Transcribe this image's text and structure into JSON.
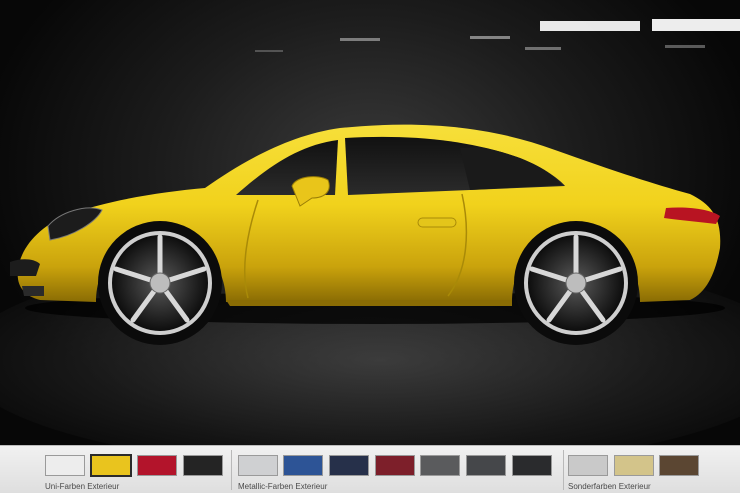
{
  "scene": {
    "subject": "car-side-view"
  },
  "palette": {
    "groups": [
      {
        "label": "Uni-Farben Exterieur",
        "swatches": [
          {
            "color": "#ededed",
            "name": "white"
          },
          {
            "color": "#e9c41e",
            "name": "yellow",
            "selected": true
          },
          {
            "color": "#b3142b",
            "name": "red"
          },
          {
            "color": "#242424",
            "name": "black"
          }
        ]
      },
      {
        "label": "Metallic-Farben Exterieur",
        "swatches": [
          {
            "color": "#cfd0d2",
            "name": "silver"
          },
          {
            "color": "#2d5496",
            "name": "blue"
          },
          {
            "color": "#26304a",
            "name": "dark-blue"
          },
          {
            "color": "#7d1f2a",
            "name": "dark-red"
          },
          {
            "color": "#5a5b5d",
            "name": "grey"
          },
          {
            "color": "#45474a",
            "name": "dark-grey"
          },
          {
            "color": "#2a2b2d",
            "name": "anthracite"
          }
        ]
      },
      {
        "label": "Sonderfarben Exterieur",
        "swatches": [
          {
            "color": "#c9c9c9",
            "name": "platinum"
          },
          {
            "color": "#d3c48a",
            "name": "beige"
          },
          {
            "color": "#5b4632",
            "name": "brown"
          }
        ]
      }
    ]
  }
}
